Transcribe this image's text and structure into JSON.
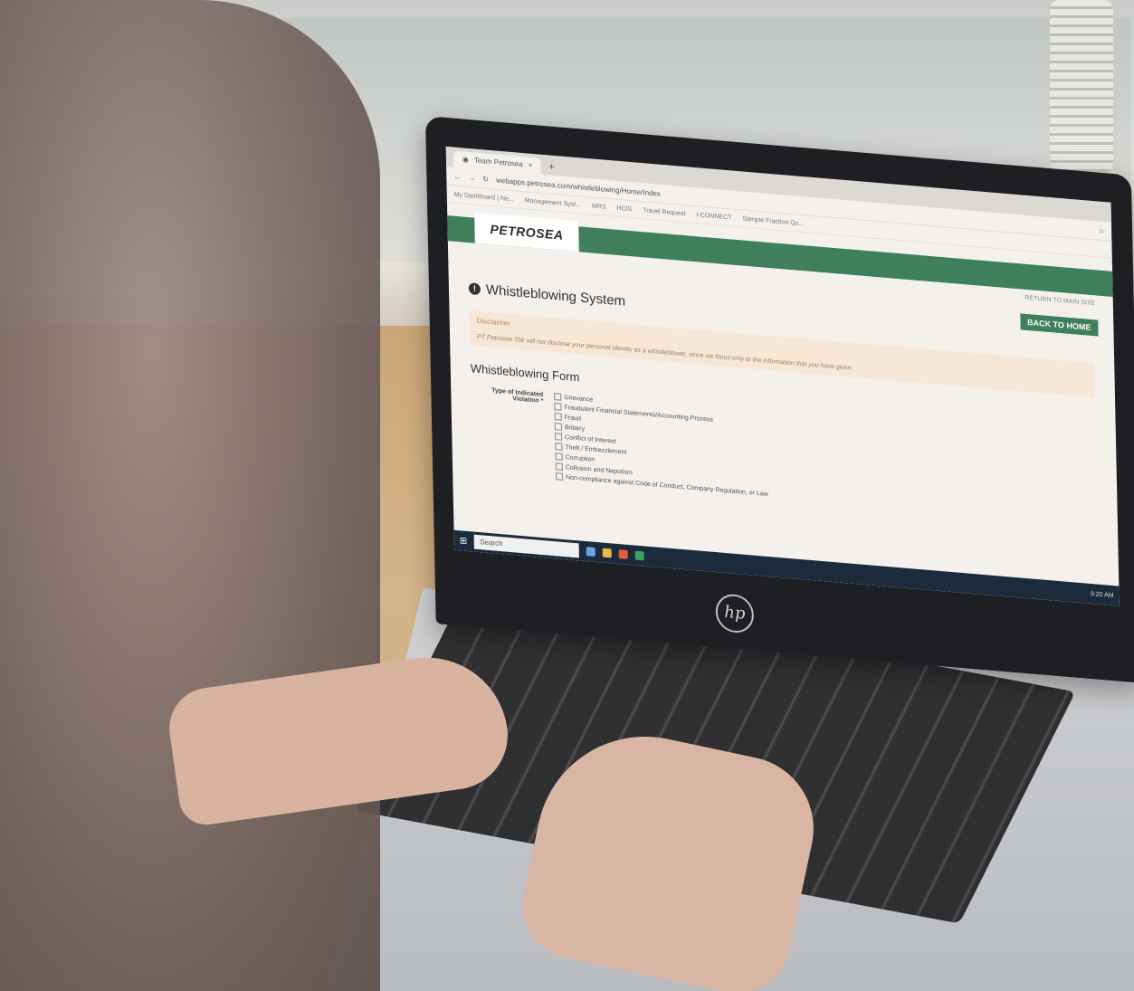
{
  "browser": {
    "tab_title": "Team Petrosea",
    "tab_new": "+",
    "url": "webapps.petrosea.com/whistleblowing/Home/Index",
    "bookmarks": [
      "My Dashboard | Ne...",
      "Management Syst...",
      "MRS",
      "HCIS",
      "Travel Request",
      "I-CONNECT",
      "Sample Fraction Qu..."
    ]
  },
  "site": {
    "logo": "PETROSEA",
    "return_link": "RETURN TO MAIN SITE",
    "back_button": "BACK TO HOME"
  },
  "page": {
    "title": "Whistleblowing System",
    "title_icon": "!",
    "disclaimer_label": "Disclaimer",
    "disclaimer_text": "PT Petrosea Tbk will not disclose your personal identity as a whistleblower, since we focus only to the information that you have given.",
    "form_title": "Whistleblowing Form",
    "field_label": "Type of Indicated Violation *",
    "options": [
      "Grievance",
      "Fraudulent Financial Statements/Accounting Process",
      "Fraud",
      "Bribery",
      "Conflict of Interest",
      "Theft / Embezzlement",
      "Corruption",
      "Collusion and Nepotism",
      "Non-compliance against Code of Conduct, Company Regulation, or Law"
    ]
  },
  "taskbar": {
    "search": "Search",
    "time": "9:20 AM"
  },
  "laptop": {
    "brand": "hp"
  },
  "colors": {
    "brand_green": "#3f7f5b",
    "disclaimer_bg": "#f6e7d6"
  }
}
